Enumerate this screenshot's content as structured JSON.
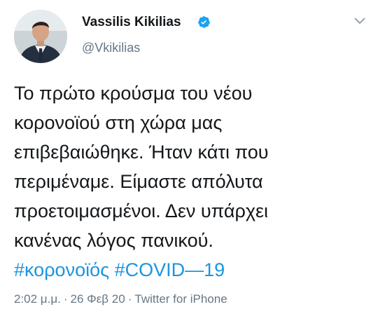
{
  "tweet": {
    "author": {
      "display_name": "Vassilis Kikilias",
      "handle": "@Vkikilias",
      "verified": true,
      "avatar_icon": "profile-photo-avatar"
    },
    "menu_icon": "chevron-down-icon",
    "body_lines": [
      "Το πρώτο κρούσμα του νέου",
      "κορονοϊού στη χώρα μας",
      "επιβεβαιώθηκε. Ήταν κάτι που",
      "περιμέναμε. Είμαστε απόλυτα",
      "προετοιμασμένοι. Δεν υπάρχει",
      "κανένας λόγος πανικού."
    ],
    "hashtags": [
      "#κορονοϊός",
      "#COVID—19"
    ],
    "meta": {
      "time": "2:02 μ.μ.",
      "separator": "·",
      "date": "26 Φεβ 20",
      "source": "Twitter for iPhone"
    }
  },
  "colors": {
    "text": "#14171a",
    "secondary_text": "#657786",
    "link": "#1b95e0",
    "verified_badge": "#1da1f2",
    "background": "#ffffff"
  }
}
